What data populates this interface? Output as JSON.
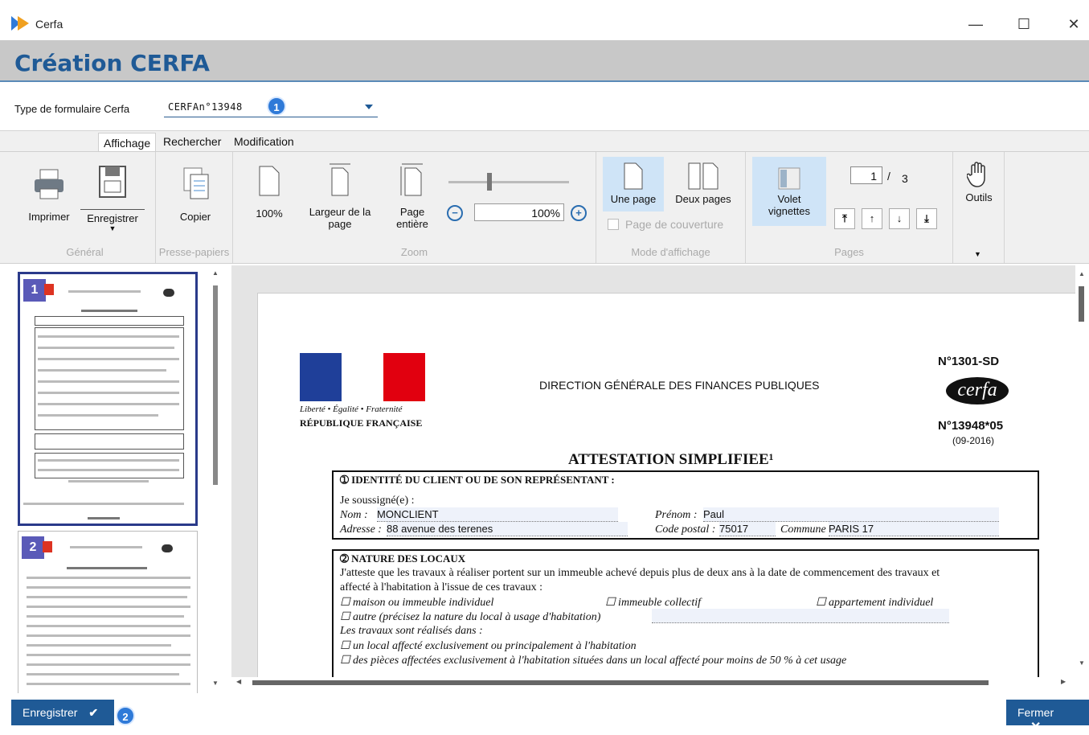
{
  "window": {
    "title": "Cerfa",
    "minimize": "—",
    "maximize": "☐",
    "close": "✕"
  },
  "header": {
    "title": "Création CERFA"
  },
  "form_type": {
    "label": "Type de formulaire Cerfa",
    "value": "CERFAn°13948",
    "badge": "1"
  },
  "tabs": [
    "Affichage",
    "Rechercher",
    "Modification"
  ],
  "ribbon": {
    "general": {
      "label": "Général",
      "print": "Imprimer",
      "save": "Enregistrer"
    },
    "clipboard": {
      "label": "Presse-papiers",
      "copy": "Copier"
    },
    "zoom": {
      "label": "Zoom",
      "p100": "100%",
      "width1": "Largeur de la",
      "width2": "page",
      "full1": "Page",
      "full2": "entière",
      "value": "100%",
      "level": 0.33
    },
    "display": {
      "label": "Mode d'affichage",
      "one": "Une page",
      "two": "Deux pages",
      "cover": "Page de couverture"
    },
    "thumbs": {
      "l1": "Volet",
      "l2": "vignettes"
    },
    "pages": {
      "label": "Pages",
      "current": "1",
      "sep": "/",
      "total": "3"
    },
    "tools": {
      "label": "Outils"
    }
  },
  "thumbnails": [
    "1",
    "2"
  ],
  "document": {
    "motto": "Liberté • Égalité • Fraternité",
    "republic": "RÉPUBLIQUE FRANÇAISE",
    "dgfp": "DIRECTION GÉNÉRALE DES FINANCES PUBLIQUES",
    "ref1": "N°1301-SD",
    "cerfa": "cerfa",
    "ref2": "N°13948*05",
    "date": "(09-2016)",
    "title": "ATTESTATION SIMPLIFIEE¹",
    "s1_title": "➀ IDENTITÉ DU CLIENT OU DE SON REPRÉSENTANT :",
    "s1_je": "Je soussigné(e) :",
    "nom_label": "Nom :",
    "nom_value": "MONCLIENT",
    "prenom_label": "Prénom :",
    "prenom_value": "Paul",
    "adresse_label": "Adresse :",
    "adresse_value": "88 avenue des terenes",
    "cp_label": "Code postal :",
    "cp_value": "75017",
    "commune_label": "Commune",
    "commune_value": "PARIS 17",
    "s2_title": "➁ NATURE DES LOCAUX",
    "s2_text1": "J'atteste que les travaux à réaliser portent sur un immeuble achevé depuis plus de deux ans à la date de commencement des travaux et",
    "s2_text2": "affecté à l'habitation à l'issue de ces travaux :",
    "cb1": "☐ maison ou immeuble individuel",
    "cb2": "☐ immeuble collectif",
    "cb3": "☐ appartement individuel",
    "cb4": "☐ autre (précisez la nature du local à usage d'habitation)",
    "s2_works": "Les travaux sont réalisés dans :",
    "cb5": "☐ un local affecté exclusivement ou principalement à l'habitation",
    "cb6": "☐ des pièces affectées exclusivement à l'habitation situées dans un local affecté pour moins de 50 % à cet usage"
  },
  "footer": {
    "save": "Enregistrer",
    "save_badge": "2",
    "close": "Fermer"
  },
  "colors": {
    "accent": "#1f5a96",
    "badge": "#2f7ad8",
    "selected": "#cfe4f7"
  }
}
